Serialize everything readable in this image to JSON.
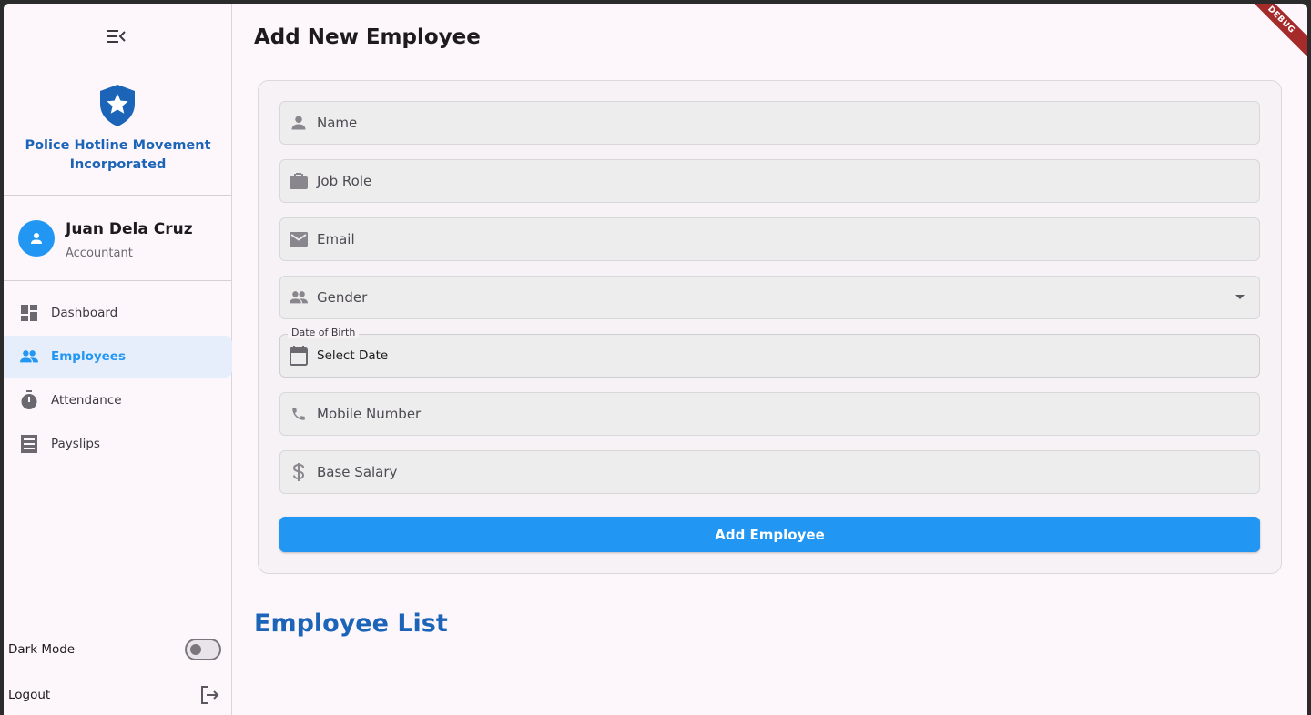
{
  "app": {
    "brand_name": "Police Hotline Movement Incorporated",
    "debug_badge": "DEBUG",
    "accent_color": "#2196f3",
    "brand_color": "#1b64b8"
  },
  "sidebar": {
    "menu_icon": "menu-collapse-icon",
    "logo_icon": "police-shield-icon",
    "profile": {
      "name": "Juan Dela Cruz",
      "role": "Accountant"
    },
    "items": [
      {
        "label": "Dashboard",
        "icon": "dashboard-icon",
        "active": false
      },
      {
        "label": "Employees",
        "icon": "people-icon",
        "active": true
      },
      {
        "label": "Attendance",
        "icon": "timer-icon",
        "active": false
      },
      {
        "label": "Payslips",
        "icon": "receipt-icon",
        "active": false
      }
    ],
    "dark_mode_label": "Dark Mode",
    "dark_mode_on": false,
    "logout_label": "Logout"
  },
  "main": {
    "title": "Add New Employee",
    "form": {
      "name_placeholder": "Name",
      "job_role_placeholder": "Job Role",
      "email_placeholder": "Email",
      "gender_placeholder": "Gender",
      "dob_label": "Date of Birth",
      "dob_value": "Select Date",
      "mobile_placeholder": "Mobile Number",
      "salary_placeholder": "Base Salary",
      "submit_label": "Add Employee"
    },
    "list_title": "Employee List"
  }
}
